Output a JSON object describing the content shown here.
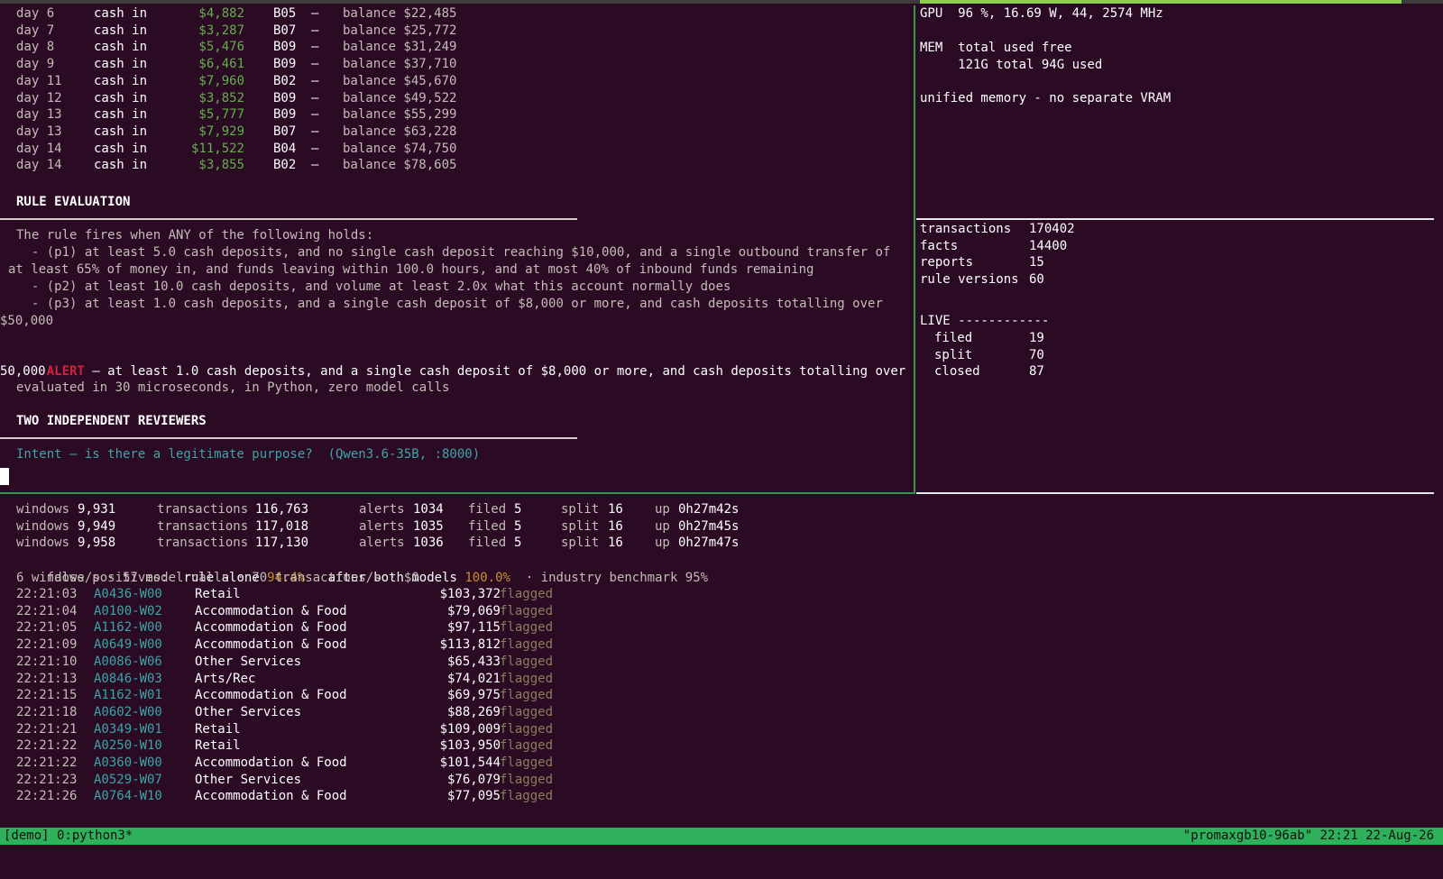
{
  "ledger": [
    {
      "day": "day 6",
      "type": "cash in",
      "amount": "$4,882",
      "branch": "B05",
      "dash": "–",
      "balance": "balance $22,485"
    },
    {
      "day": "day 7",
      "type": "cash in",
      "amount": "$3,287",
      "branch": "B07",
      "dash": "–",
      "balance": "balance $25,772"
    },
    {
      "day": "day 8",
      "type": "cash in",
      "amount": "$5,476",
      "branch": "B09",
      "dash": "–",
      "balance": "balance $31,249"
    },
    {
      "day": "day 9",
      "type": "cash in",
      "amount": "$6,461",
      "branch": "B09",
      "dash": "–",
      "balance": "balance $37,710"
    },
    {
      "day": "day 11",
      "type": "cash in",
      "amount": "$7,960",
      "branch": "B02",
      "dash": "–",
      "balance": "balance $45,670"
    },
    {
      "day": "day 12",
      "type": "cash in",
      "amount": "$3,852",
      "branch": "B09",
      "dash": "–",
      "balance": "balance $49,522"
    },
    {
      "day": "day 13",
      "type": "cash in",
      "amount": "$5,777",
      "branch": "B09",
      "dash": "–",
      "balance": "balance $55,299"
    },
    {
      "day": "day 13",
      "type": "cash in",
      "amount": "$7,929",
      "branch": "B07",
      "dash": "–",
      "balance": "balance $63,228"
    },
    {
      "day": "day 14",
      "type": "cash in",
      "amount": "$11,522",
      "branch": "B04",
      "dash": "–",
      "balance": "balance $74,750"
    },
    {
      "day": "day 14",
      "type": "cash in",
      "amount": "$3,855",
      "branch": "B02",
      "dash": "–",
      "balance": "balance $78,605"
    }
  ],
  "rule": {
    "heading": "RULE EVALUATION",
    "intro": "The rule fires when ANY of the following holds:",
    "p1_line1": "  - (p1) at least 5.0 cash deposits, and no single cash deposit reaching $10,000, and a single outbound transfer of",
    "p1_line2": "at least 65% of money in, and funds leaving within 100.0 hours, and at most 40% of inbound funds remaining",
    "p2": "  - (p2) at least 10.0 cash deposits, and volume at least 2.0x what this account normally does",
    "p3_line1": "  - (p3) at least 1.0 cash deposits, and a single cash deposit of $8,000 or more, and cash deposits totalling over",
    "p3_line2": "$50,000",
    "alert_label": "ALERT",
    "alert_line1": " – at least 1.0 cash deposits, and a single cash deposit of $8,000 or more, and cash deposits totalling over $",
    "alert_line2": "50,000",
    "evaluated": "evaluated in 30 microseconds, in Python, zero model calls"
  },
  "reviewers": {
    "heading": "TWO INDEPENDENT REVIEWERS",
    "intent": "Intent – is there a legitimate purpose?  (Qwen3.6-35B, :8000)"
  },
  "gpu": {
    "line": "GPU  96 %, 16.69 W, 44, 2574 MHz",
    "mem_line1": "MEM  total used free",
    "mem_line2": "     121G total 94G used",
    "unified": "unified memory - no separate VRAM"
  },
  "stats": [
    {
      "label": "transactions",
      "value": "170402"
    },
    {
      "label": "facts",
      "value": "14400"
    },
    {
      "label": "reports",
      "value": "15"
    },
    {
      "label": "rule versions",
      "value": "60"
    }
  ],
  "live": {
    "heading": "LIVE ------------",
    "items": [
      {
        "label": "filed",
        "value": "19"
      },
      {
        "label": "split",
        "value": "70"
      },
      {
        "label": "closed",
        "value": "87"
      }
    ]
  },
  "progress": [
    {
      "windows_label": "windows",
      "windows": "9,931",
      "tx_label": "transactions",
      "tx": "116,763",
      "alerts_label": "alerts",
      "alerts": "1034",
      "filed_label": "filed",
      "filed": "5",
      "split_label": "split",
      "split": "16",
      "up_label": "up",
      "up": "0h27m42s"
    },
    {
      "windows_label": "windows",
      "windows": "9,949",
      "tx_label": "transactions",
      "tx": "117,018",
      "alerts_label": "alerts",
      "alerts": "1035",
      "filed_label": "filed",
      "filed": "5",
      "split_label": "split",
      "split": "16",
      "up_label": "up",
      "up": "0h27m45s"
    },
    {
      "windows_label": "windows",
      "windows": "9,958",
      "tx_label": "transactions",
      "tx": "117,130",
      "alerts_label": "alerts",
      "alerts": "1036",
      "filed_label": "filed",
      "filed": "5",
      "split_label": "split",
      "split": "16",
      "up_label": "up",
      "up": "0h27m47s"
    }
  ],
  "false_positives": {
    "label": "false positives:",
    "rule_label": "rule alone",
    "rule_value": "94.4%",
    "both_label": "after both models",
    "both_value": "100.0%",
    "bench": "· industry benchmark 95%"
  },
  "throughput": "6 windows/s · 57 model calls · 70 transactions/s · $0",
  "alerts_log": [
    {
      "time": "22:21:03",
      "id": "A0436-W00",
      "sector": "Retail",
      "amount": "$103,372",
      "status": "flagged"
    },
    {
      "time": "22:21:04",
      "id": "A0100-W02",
      "sector": "Accommodation & Food",
      "amount": "$79,069",
      "status": "flagged"
    },
    {
      "time": "22:21:05",
      "id": "A1162-W00",
      "sector": "Accommodation & Food",
      "amount": "$97,115",
      "status": "flagged"
    },
    {
      "time": "22:21:09",
      "id": "A0649-W00",
      "sector": "Accommodation & Food",
      "amount": "$113,812",
      "status": "flagged"
    },
    {
      "time": "22:21:10",
      "id": "A0086-W06",
      "sector": "Other Services",
      "amount": "$65,433",
      "status": "flagged"
    },
    {
      "time": "22:21:13",
      "id": "A0846-W03",
      "sector": "Arts/Rec",
      "amount": "$74,021",
      "status": "flagged"
    },
    {
      "time": "22:21:15",
      "id": "A1162-W01",
      "sector": "Accommodation & Food",
      "amount": "$69,975",
      "status": "flagged"
    },
    {
      "time": "22:21:18",
      "id": "A0602-W00",
      "sector": "Other Services",
      "amount": "$88,269",
      "status": "flagged"
    },
    {
      "time": "22:21:21",
      "id": "A0349-W01",
      "sector": "Retail",
      "amount": "$109,009",
      "status": "flagged"
    },
    {
      "time": "22:21:22",
      "id": "A0250-W10",
      "sector": "Retail",
      "amount": "$103,950",
      "status": "flagged"
    },
    {
      "time": "22:21:22",
      "id": "A0360-W00",
      "sector": "Accommodation & Food",
      "amount": "$101,544",
      "status": "flagged"
    },
    {
      "time": "22:21:23",
      "id": "A0529-W07",
      "sector": "Other Services",
      "amount": "$76,079",
      "status": "flagged"
    },
    {
      "time": "22:21:26",
      "id": "A0764-W10",
      "sector": "Accommodation & Food",
      "amount": "$77,095",
      "status": "flagged"
    }
  ],
  "status_bar": {
    "left": "[demo] 0:python3*",
    "right": "\"promaxgb10-96ab\" 22:21 22-Aug-26"
  },
  "colors": {
    "background": "#2b0a24",
    "pane_border": "#2f9a4a",
    "status_bar": "#2fb05a",
    "money_in": "#63b04a",
    "account_id": "#3aa6a6",
    "alert": "#d3233a",
    "percent": "#c8902a"
  }
}
